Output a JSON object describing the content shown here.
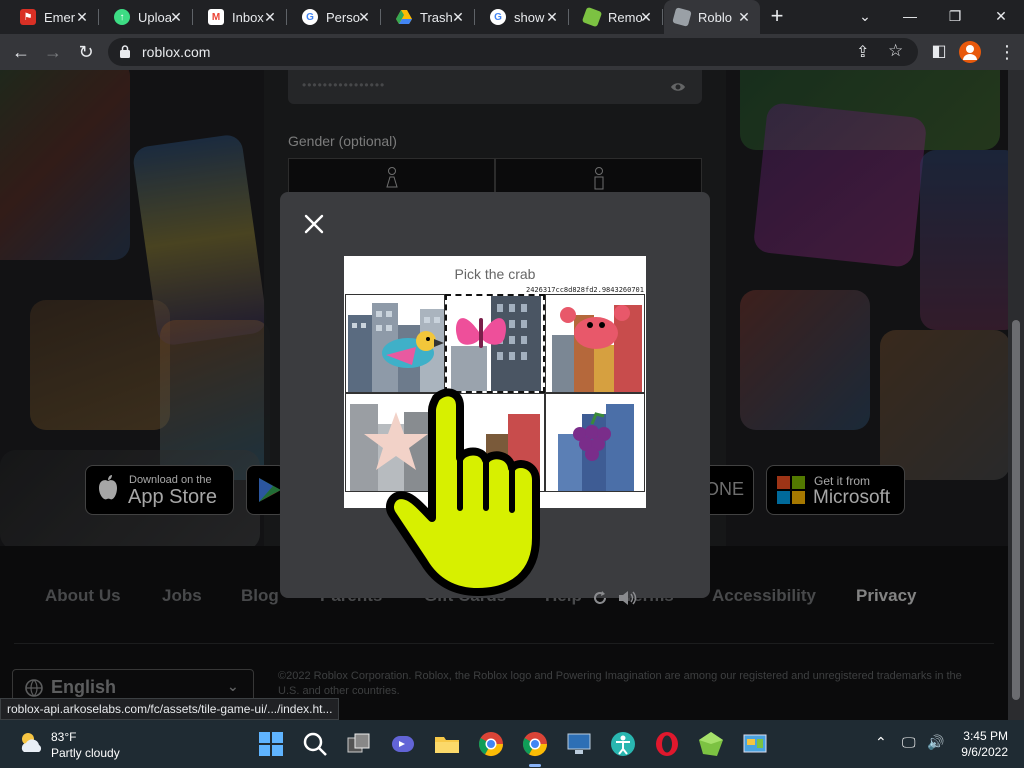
{
  "browser": {
    "tabs": [
      {
        "title": "Emer",
        "icon": "red-flag-icon",
        "color": "#d93025"
      },
      {
        "title": "Uploa",
        "icon": "cloud-upload-icon",
        "color": "#3ddc84"
      },
      {
        "title": "Inbox",
        "icon": "gmail-icon",
        "color": "#ea4335"
      },
      {
        "title": "Perso",
        "icon": "google-icon",
        "color": "#4285f4"
      },
      {
        "title": "Trash",
        "icon": "google-drive-icon",
        "color": "#fbbc04"
      },
      {
        "title": "show",
        "icon": "google-icon",
        "color": "#4285f4"
      },
      {
        "title": "Remo",
        "icon": "green-cube-icon",
        "color": "#7cc242"
      },
      {
        "title": "Roblo",
        "icon": "roblox-icon",
        "color": "#9aa0a6"
      }
    ],
    "new_tab": "+",
    "url": "roblox.com"
  },
  "signup": {
    "password_mask": "••••••••••••••••",
    "gender_label": "Gender (optional)"
  },
  "store_buttons": {
    "app_store_small": "Download on the",
    "app_store_big": "App Store",
    "xbox_partial": "ONE",
    "microsoft_small": "Get it from",
    "microsoft_big": "Microsoft"
  },
  "footer": {
    "links": [
      "About Us",
      "Jobs",
      "Blog",
      "Parents",
      "Gift Cards",
      "Help",
      "Terms",
      "Accessibility",
      "Privacy"
    ],
    "language": "English",
    "copyright": "©2022 Roblox Corporation. Roblox, the Roblox logo and Powering Imagination are among our registered and unregistered trademarks in the U.S. and other countries."
  },
  "captcha": {
    "prompt": "Pick the crab",
    "hash": "2426317cc8d828fd2.9843260701",
    "tiles": [
      "parrot",
      "butterfly",
      "crab",
      "starfish",
      "chipmunk",
      "grapes"
    ],
    "selected_tile_index": 1
  },
  "status_bar": {
    "url": "roblox-api.arkoselabs.com/fc/assets/tile-game-ui/.../index.ht..."
  },
  "taskbar": {
    "temperature": "83°F",
    "weather": "Partly cloudy",
    "time": "3:45 PM",
    "date": "9/6/2022"
  },
  "colors": {
    "highlight_hand": "#d7f000",
    "accent": "#8ab4f8"
  }
}
